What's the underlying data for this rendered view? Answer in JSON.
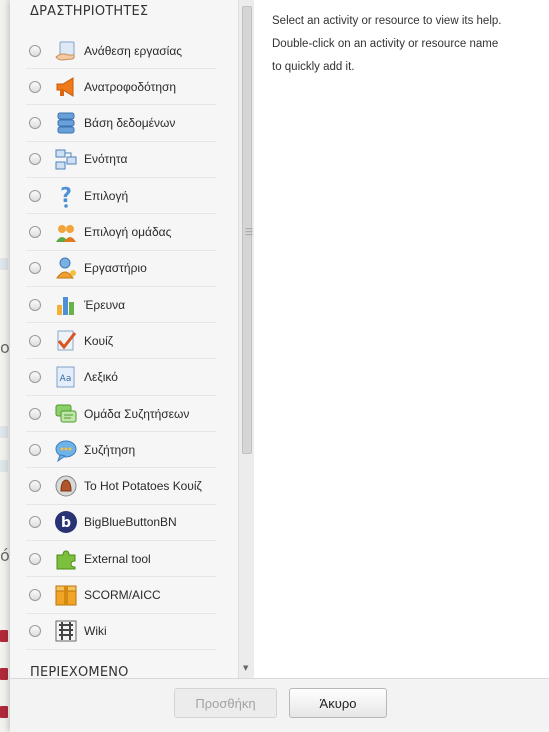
{
  "sections": {
    "activities_header": "ΔΡΑΣΤΗΡΙΟΤΗΤΕΣ",
    "resources_header": "ΠΕΡΙΕΧΟΜΕΝΟ"
  },
  "activities": [
    {
      "label": "Ανάθεση εργασίας",
      "icon": "assignment-icon"
    },
    {
      "label": "Ανατροφοδότηση",
      "icon": "feedback-megaphone-icon"
    },
    {
      "label": "Βάση δεδομένων",
      "icon": "database-icon"
    },
    {
      "label": "Ενότητα",
      "icon": "lesson-icon"
    },
    {
      "label": "Επιλογή",
      "icon": "choice-question-icon"
    },
    {
      "label": "Επιλογή ομάδας",
      "icon": "group-choice-icon"
    },
    {
      "label": "Εργαστήριο",
      "icon": "workshop-icon"
    },
    {
      "label": "Έρευνα",
      "icon": "survey-chart-icon"
    },
    {
      "label": "Κουίζ",
      "icon": "quiz-icon"
    },
    {
      "label": "Λεξικό",
      "icon": "glossary-icon"
    },
    {
      "label": "Ομάδα Συζητήσεων",
      "icon": "forum-icon"
    },
    {
      "label": "Συζήτηση",
      "icon": "chat-icon"
    },
    {
      "label": "Το Hot Potatoes Κουίζ",
      "icon": "hotpot-icon"
    },
    {
      "label": "BigBlueButtonBN",
      "icon": "bigbluebutton-icon"
    },
    {
      "label": "External tool",
      "icon": "external-tool-puzzle-icon"
    },
    {
      "label": "SCORM/AICC",
      "icon": "scorm-package-icon"
    },
    {
      "label": "Wiki",
      "icon": "wiki-icon"
    }
  ],
  "help": {
    "line1": "Select an activity or resource to view its help.",
    "line2": "Double-click on an activity or resource name",
    "line3": "to quickly add it."
  },
  "footer": {
    "add_label": "Προσθήκη",
    "cancel_label": "Άκυρο"
  }
}
